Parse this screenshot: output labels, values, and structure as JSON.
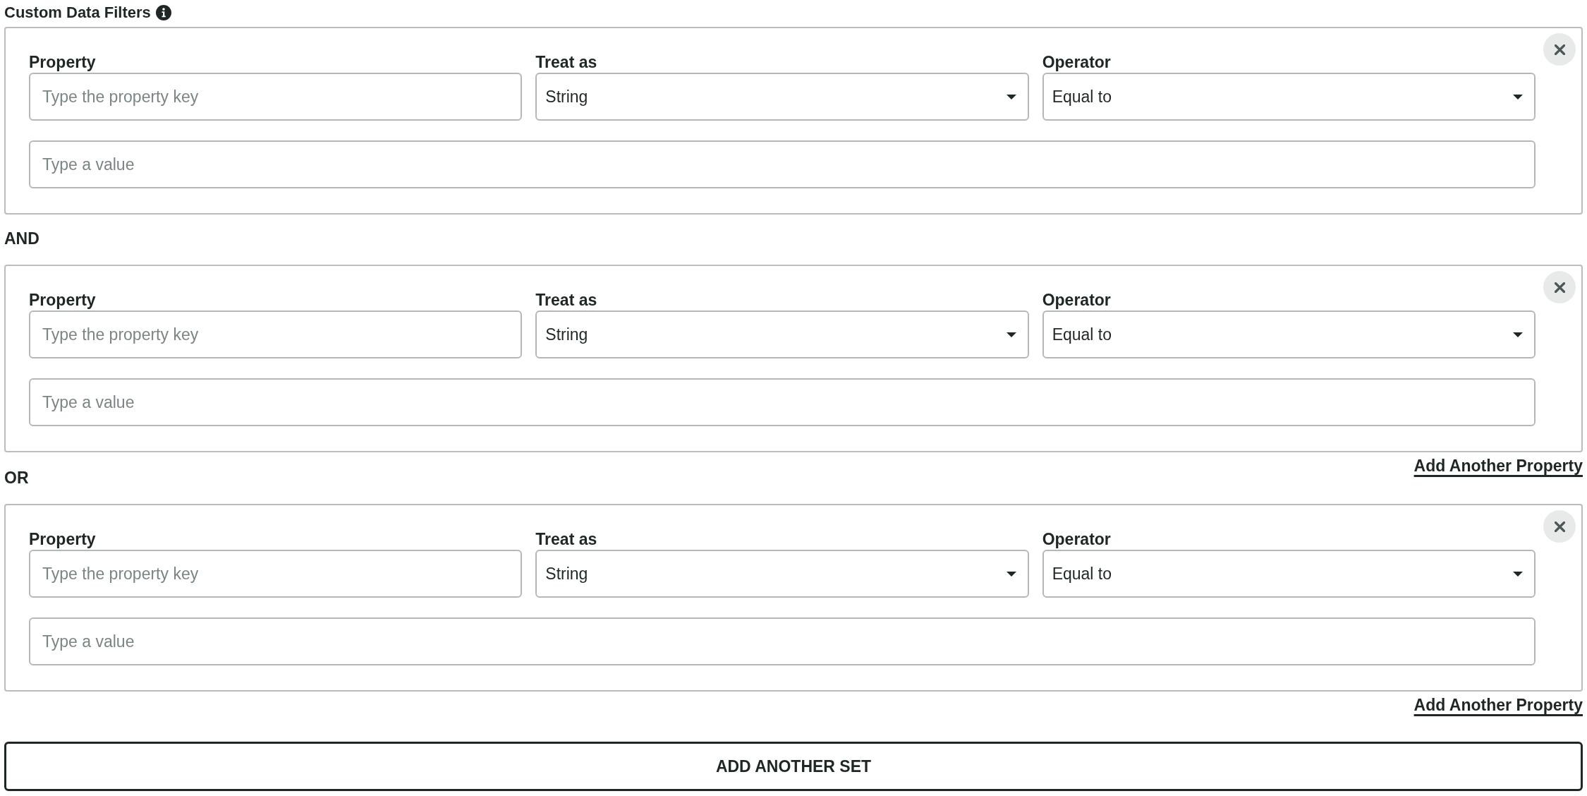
{
  "section": {
    "title": "Custom Data Filters"
  },
  "sets": [
    {
      "conditions": [
        {
          "property": {
            "label": "Property",
            "placeholder": "Type the property key"
          },
          "treat_as": {
            "label": "Treat as",
            "value": "String"
          },
          "operator": {
            "label": "Operator",
            "value": "Equal to"
          },
          "value": {
            "placeholder": "Type a value"
          }
        },
        {
          "joiner": "AND",
          "property": {
            "label": "Property",
            "placeholder": "Type the property key"
          },
          "treat_as": {
            "label": "Treat as",
            "value": "String"
          },
          "operator": {
            "label": "Operator",
            "value": "Equal to"
          },
          "value": {
            "placeholder": "Type a value"
          }
        }
      ],
      "add_property_link": "Add Another Property"
    },
    {
      "joiner": "OR",
      "conditions": [
        {
          "property": {
            "label": "Property",
            "placeholder": "Type the property key"
          },
          "treat_as": {
            "label": "Treat as",
            "value": "String"
          },
          "operator": {
            "label": "Operator",
            "value": "Equal to"
          },
          "value": {
            "placeholder": "Type a value"
          }
        }
      ],
      "add_property_link": "Add Another Property"
    }
  ],
  "add_set_button": "ADD ANOTHER SET"
}
